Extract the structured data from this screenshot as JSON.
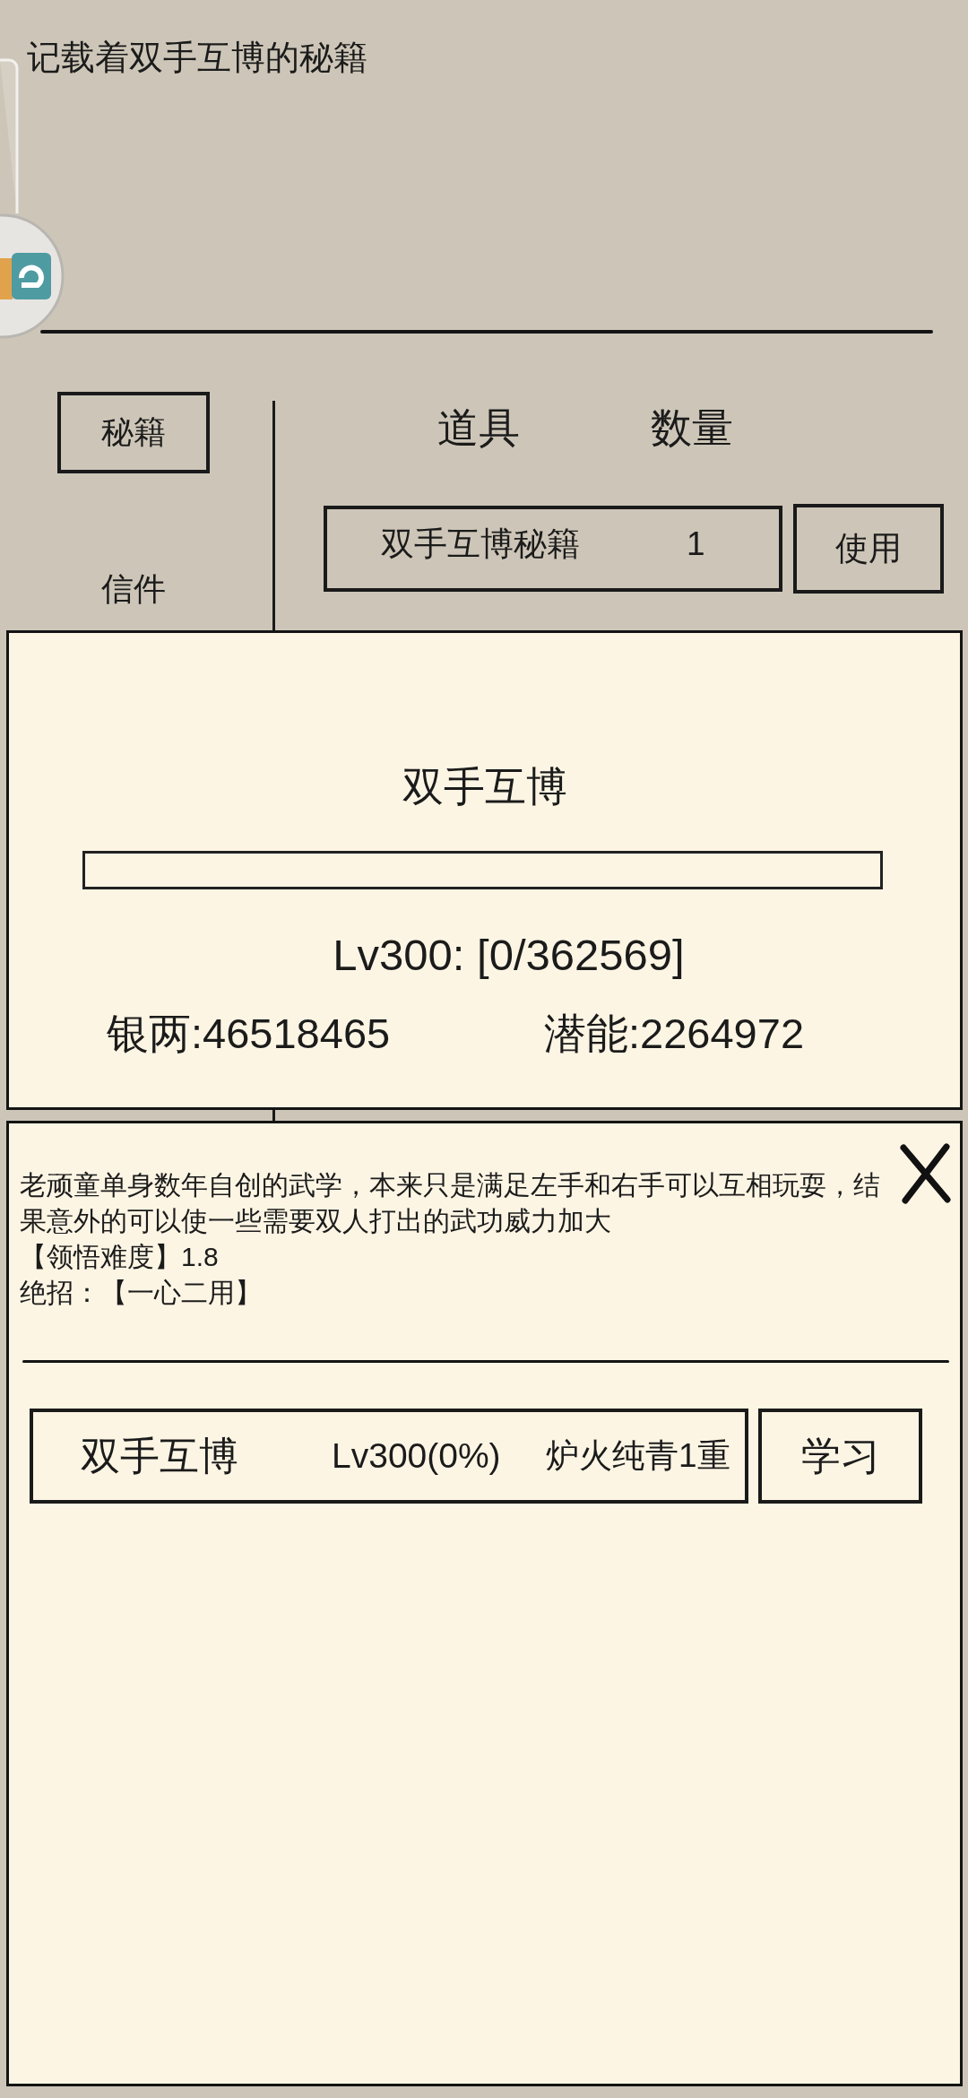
{
  "header": {
    "description": "记载着双手互博的秘籍"
  },
  "sidebar": {
    "items": [
      {
        "label": "秘籍",
        "selected": true
      },
      {
        "label": "信件",
        "selected": false
      }
    ]
  },
  "inventory": {
    "columns": [
      "道具",
      "数量"
    ],
    "rows": [
      {
        "name": "双手互博秘籍",
        "count": "1",
        "action": "使用"
      }
    ]
  },
  "skill_panel": {
    "title": "双手互博",
    "progress": {
      "level": 0
    },
    "level_text": "Lv300: [0/362569]",
    "stats": [
      "银两:46518465",
      "潜能:2264972"
    ]
  },
  "detail_panel": {
    "description": "老顽童单身数年自创的武学，本来只是满足左手和右手可以互相玩耍，结果意外的可以使一些需要双人打出的武功威力加大",
    "lines": [
      "【领悟难度】1.8",
      "绝招：【一心二用】"
    ],
    "skill": {
      "name": "双手互博",
      "level": "Lv300(0%)",
      "rank": "炉火纯青1重",
      "action": "学习"
    }
  }
}
